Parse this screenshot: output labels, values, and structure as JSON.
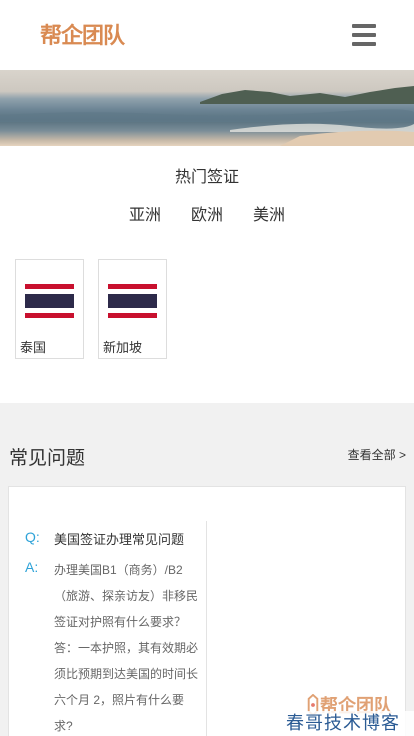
{
  "header": {
    "logo_text": "帮企团队",
    "menu_icon": "hamburger-menu-icon"
  },
  "hot_visa": {
    "title": "热门签证",
    "regions": [
      "亚洲",
      "欧洲",
      "美洲"
    ],
    "countries": [
      {
        "name": "泰国",
        "flag_icon": "thailand-flag-icon"
      },
      {
        "name": "新加坡",
        "flag_icon": "thailand-flag-icon"
      }
    ]
  },
  "faq": {
    "title": "常见问题",
    "more_label": "查看全部 >",
    "items": [
      {
        "q_tag": "Q:",
        "question": "美国签证办理常见问题",
        "a_tag": "A:",
        "answer": "办理美国B1（商务）/B2（旅游、探亲访友）非移民签证对护照有什么要求？ 答：一本护照，其有效期必须比预期到达美国的时间长六个月 2，照片有什么要求?"
      }
    ]
  },
  "watermark": {
    "logo_text": "帮企团队",
    "text": "春哥技术博客"
  },
  "colors": {
    "accent_blue": "#2fa3d8",
    "logo_orange": "#d98a52",
    "flag_red": "#c8102e",
    "flag_navy": "#2d2a4a"
  }
}
